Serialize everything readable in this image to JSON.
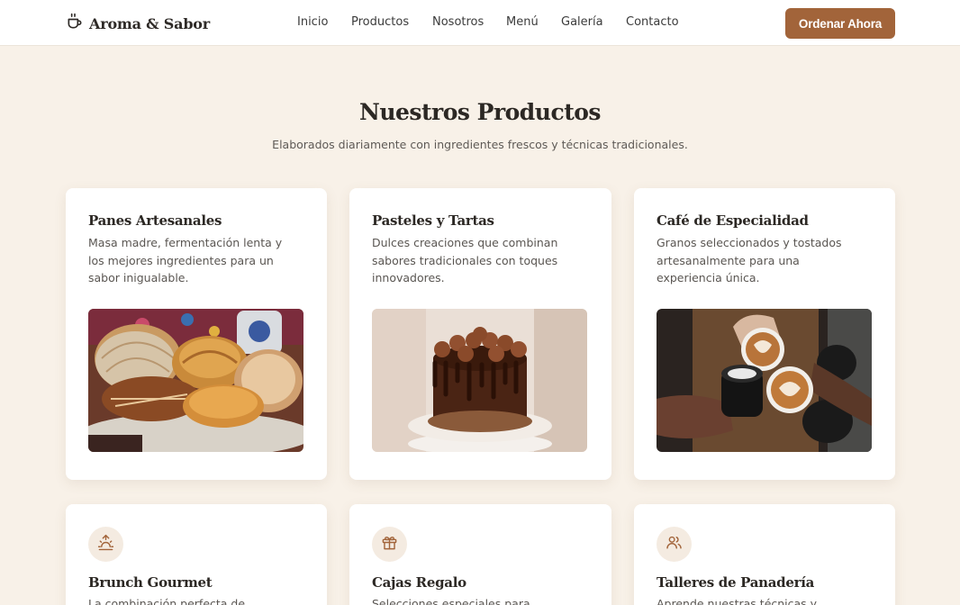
{
  "brand": {
    "name": "Aroma & Sabor",
    "icon": "coffee-cup-icon"
  },
  "nav": {
    "items": [
      "Inicio",
      "Productos",
      "Nosotros",
      "Menú",
      "Galería",
      "Contacto"
    ],
    "cta": "Ordenar Ahora"
  },
  "section": {
    "title": "Nuestros Productos",
    "subtitle": "Elaborados diariamente con ingredientes frescos y técnicas tradicionales."
  },
  "products": [
    {
      "title": "Panes Artesanales",
      "desc": "Masa madre, fermentación lenta y los mejores ingredientes para un sabor inigualable.",
      "image": "mexican-sweet-bread-photo"
    },
    {
      "title": "Pasteles y Tartas",
      "desc": "Dulces creaciones que combinan sabores tradicionales con toques innovadores.",
      "image": "chocolate-cake-photo"
    },
    {
      "title": "Café de Especialidad",
      "desc": "Granos seleccionados y tostados artesanalmente para una experiencia única.",
      "image": "latte-art-cups-photo"
    }
  ],
  "services": [
    {
      "title": "Brunch Gourmet",
      "desc": "La combinación perfecta de",
      "icon": "sunrise-icon"
    },
    {
      "title": "Cajas Regalo",
      "desc": "Selecciones especiales para",
      "icon": "gift-icon"
    },
    {
      "title": "Talleres de Panadería",
      "desc": "Aprende nuestras técnicas y",
      "icon": "users-icon"
    }
  ],
  "colors": {
    "accent": "#a2643a",
    "background": "#f8f1e8",
    "icon_bg": "#f4ebe1"
  }
}
